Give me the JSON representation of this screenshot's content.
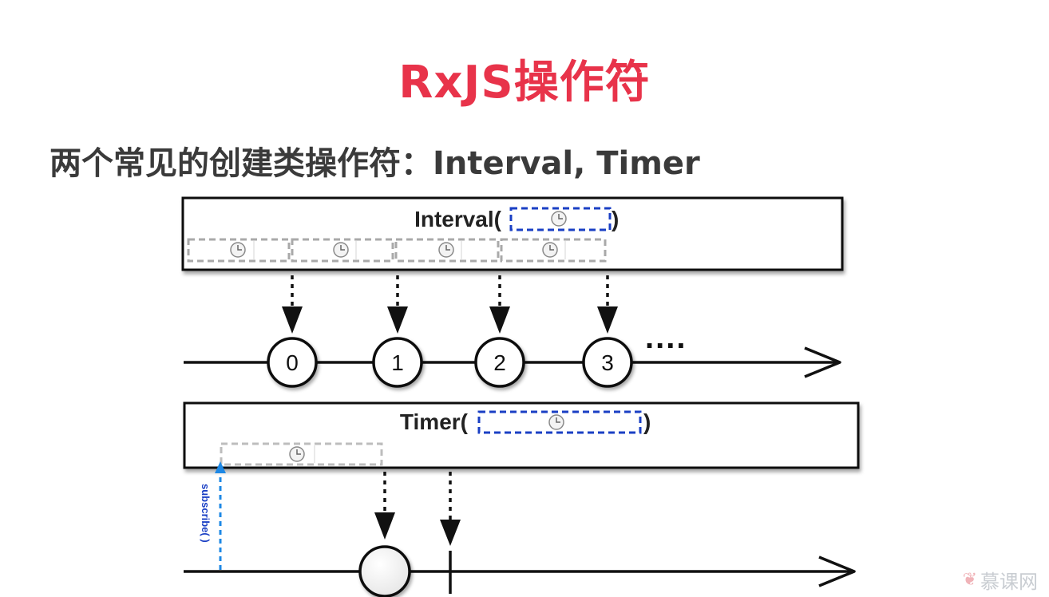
{
  "title": "RxJS操作符",
  "subtitle": "两个常见的创建类操作符：Interval, Timer",
  "interval": {
    "label_open": "Interval(",
    "label_close": ")",
    "values": [
      "0",
      "1",
      "2",
      "3"
    ],
    "ellipsis": "...."
  },
  "timer": {
    "label_open": "Timer(",
    "label_close": ")",
    "subscribe_label": "subscribe( )"
  },
  "watermark": "慕课网",
  "colors": {
    "title": "#e8334a",
    "subtitle": "#3a3a3a",
    "dashed_blue": "#1a3fc4",
    "dashed_gray": "#a9a9a9",
    "subscribe": "#1e88e5"
  },
  "icons": [
    "clock-icon",
    "arrow-down-icon",
    "arrow-right-icon",
    "flame-icon"
  ]
}
